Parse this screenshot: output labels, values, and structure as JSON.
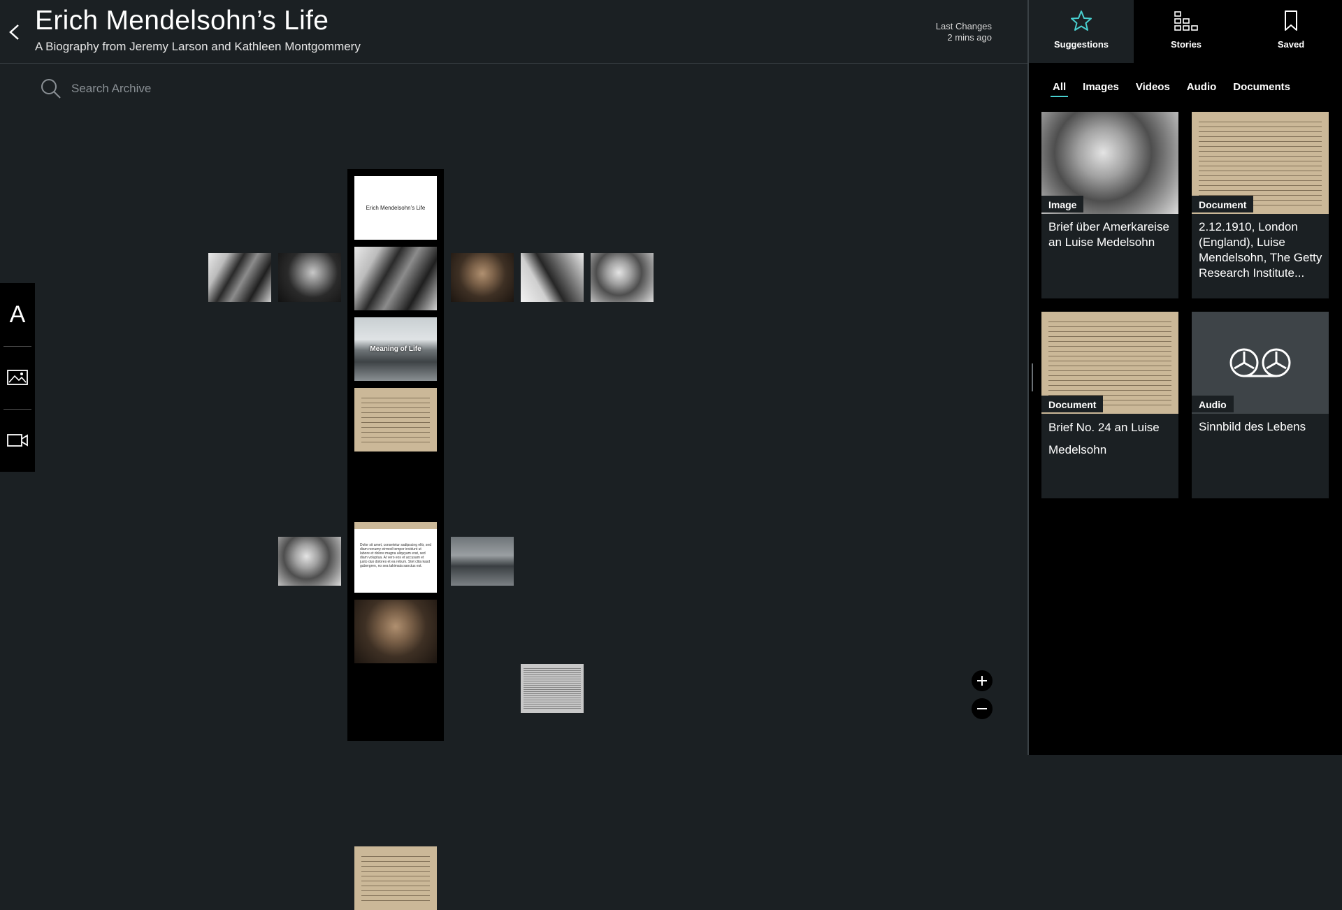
{
  "header": {
    "title": "Erich Mendelsohn’s Life",
    "subtitle": "A Biography from Jeremy Larson and Kathleen Montgommery",
    "last_changes_label": "Last Changes",
    "last_changes_value": "2 mins ago"
  },
  "search": {
    "placeholder": "Search Archive"
  },
  "toolbar": {
    "text_tool_label": "A"
  },
  "canvas": {
    "title_tile_text": "Erich Mendelsohn’s Life",
    "meaning_tile_text": "Meaning of Life",
    "text_tile_text": "Dolor sit amet, consetetur sadipscing elitr, sed diam nonumy eirmod tempor invidunt ut labore et dolore magna aliquyam erat, sed diam voluptua. At vero eos et accusam et justo duo dolores et ea rebum. Stet clita kasd gubergren, no sea takimata sanctus est."
  },
  "panel": {
    "tabs": [
      {
        "label": "Suggestions",
        "icon": "star-icon",
        "active": true
      },
      {
        "label": "Stories",
        "icon": "stories-icon",
        "active": false
      },
      {
        "label": "Saved",
        "icon": "bookmark-icon",
        "active": false
      }
    ],
    "filters": [
      {
        "label": "All",
        "active": true
      },
      {
        "label": "Images",
        "active": false
      },
      {
        "label": "Videos",
        "active": false
      },
      {
        "label": "Audio",
        "active": false
      },
      {
        "label": "Documents",
        "active": false
      }
    ],
    "cards": [
      {
        "type": "Image",
        "title": "Brief über Amerkareise an Luise Medelsohn"
      },
      {
        "type": "Document",
        "title": "2.12.1910, London (England), Luise Mendelsohn, The Getty Research Institute..."
      },
      {
        "type": "Document",
        "title": "Brief No. 24 an Luise Medelsohn"
      },
      {
        "type": "Audio",
        "title": "Sinnbild des Lebens"
      }
    ]
  },
  "colors": {
    "accent": "#49d0d0",
    "background": "#1b2023",
    "panel": "#000000"
  }
}
